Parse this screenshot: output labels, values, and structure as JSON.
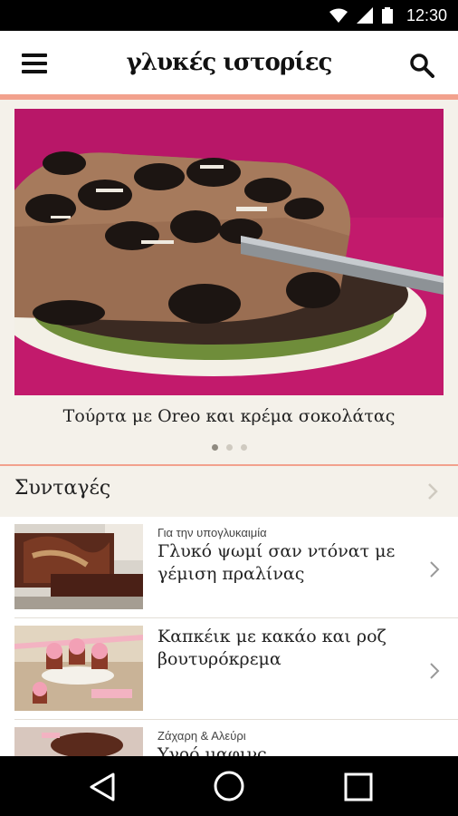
{
  "status_bar": {
    "time": "12:30"
  },
  "app_bar": {
    "logo": "γλυκές ιστορίες"
  },
  "hero": {
    "caption": "Τούρτα με Oreo και κρέμα σοκολάτας",
    "page": 1,
    "page_count": 3
  },
  "section": {
    "title": "Συνταγές"
  },
  "recipes": [
    {
      "category": "Για την υπογλυκαιμία",
      "title_line1": "Γλυκό ψωμί σαν ντόνατ με",
      "title_line2": "γέμιση πραλίνας"
    },
    {
      "category": "",
      "title_line1": "Καπκέικ με κακάο και ροζ",
      "title_line2": "βουτυρόκρεμα"
    },
    {
      "category": "Ζάχαρη & Αλεύρι",
      "title_line1": "Υγρό μαφινς",
      "title_line2": ""
    }
  ],
  "colors": {
    "accent": "#f2a18d",
    "background": "#f4f1ea",
    "hero_bg": "#c21a6c"
  }
}
